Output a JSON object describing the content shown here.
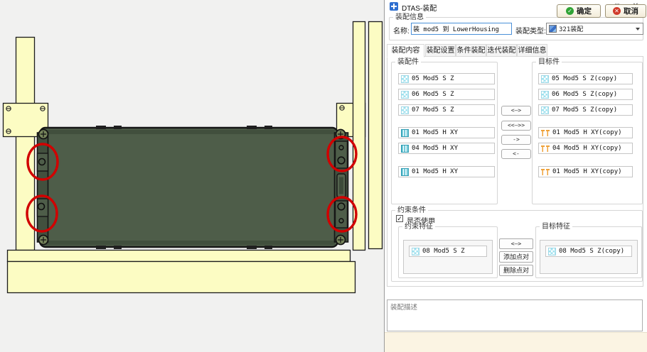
{
  "window": {
    "title": "DTAS-装配",
    "minimize": "–",
    "maximize": "□",
    "close": "✕"
  },
  "assembly_info": {
    "group_label": "装配信息",
    "name_label": "名称:",
    "name_value": "装 mod5 到 LowerHousing",
    "type_label": "装配类型:",
    "type_value": "321装配"
  },
  "tabs": [
    {
      "label": "装配内容"
    },
    {
      "label": "装配设置"
    },
    {
      "label": "条件装配"
    },
    {
      "label": "迭代装配"
    },
    {
      "label": "详细信息"
    }
  ],
  "content": {
    "source_group_label": "装配件",
    "target_group_label": "目标件",
    "source_items": [
      {
        "icon": "surface",
        "label": "05 Mod5 S Z"
      },
      {
        "icon": "surface",
        "label": "06 Mod5 S Z"
      },
      {
        "icon": "surface",
        "label": "07 Mod5 S Z"
      },
      {
        "icon": "hole",
        "label": "01 Mod5 H XY"
      },
      {
        "icon": "hole",
        "label": "04 Mod5 H XY"
      },
      {
        "icon": "hole",
        "label": "01 Mod5 H XY"
      }
    ],
    "target_items": [
      {
        "icon": "surface",
        "label": "05 Mod5 S Z(copy)"
      },
      {
        "icon": "surface",
        "label": "06 Mod5 S Z(copy)"
      },
      {
        "icon": "surface",
        "label": "07 Mod5 S Z(copy)"
      },
      {
        "icon": "pin",
        "label": "01 Mod5 H XY(copy)"
      },
      {
        "icon": "pin",
        "label": "04 Mod5 H XY(copy)"
      },
      {
        "icon": "pin",
        "label": "01 Mod5 H XY(copy)"
      }
    ],
    "transfer_buttons": [
      "<—>",
      "<<—>>",
      "->",
      "<-"
    ]
  },
  "constraint": {
    "group_label": "约束条件",
    "use_label": "是否使用",
    "check_glyph": "✓",
    "left_group_label": "约束特征",
    "right_group_label": "目标特征",
    "left_item": "08 Mod5 S Z",
    "right_item": "08 Mod5 S Z(copy)",
    "map_button": "<—>",
    "add_button": "添加点对",
    "remove_button": "删除点对"
  },
  "description": {
    "placeholder": "装配描述"
  },
  "footer": {
    "ok": "确定",
    "cancel": "取消",
    "ok_glyph": "✓",
    "cancel_glyph": "✕"
  },
  "colors": {
    "focus_blue": "#4A90D9",
    "highlight_red": "#D10000",
    "fixture_yellow": "#FCFCC3",
    "housing_green": "#4E5D49",
    "ok_green": "#2FA335",
    "cancel_red": "#D03A2A"
  }
}
